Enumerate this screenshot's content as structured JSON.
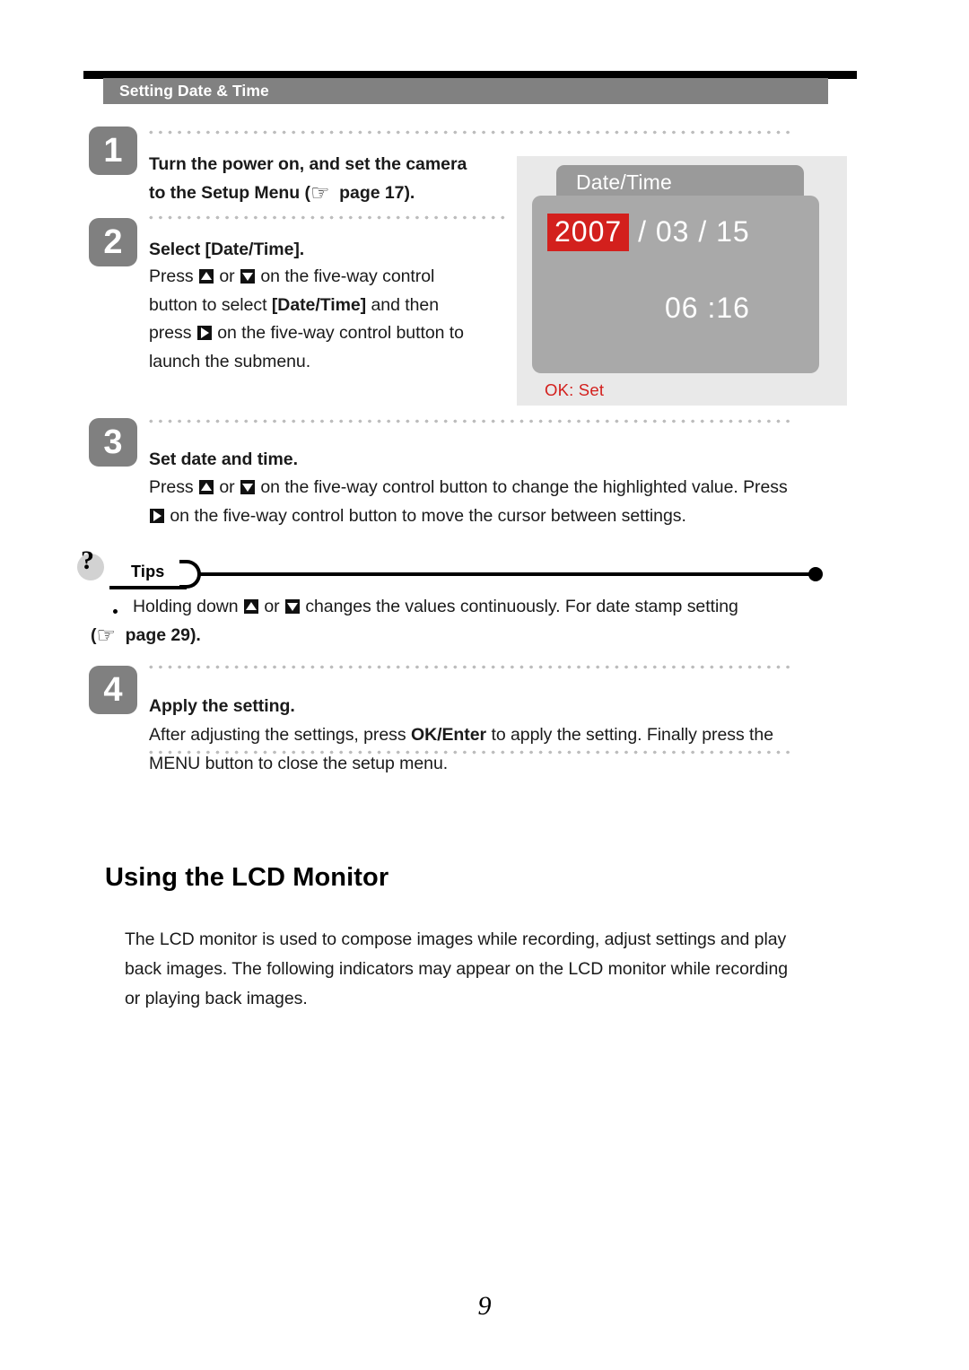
{
  "header": {
    "title": "Setting Date & Time"
  },
  "steps": [
    {
      "number": "1",
      "heading_line1": "Turn the power on, and set the camera",
      "heading_line2_pre": "to the Setup Menu (",
      "heading_icon": "pointing-hand-icon",
      "heading_line2_post": "page 17)."
    },
    {
      "number": "2",
      "heading": "Select [Date/Time].",
      "body_1": "Press",
      "body_2": "or",
      "body_3": "on the five-way control",
      "body_4": "button to select",
      "body_4b": "[Date/Time]",
      "body_4c": "and then",
      "body_5": "press",
      "body_6": "on the five-way control button to",
      "body_7": "launch the submenu."
    },
    {
      "number": "3",
      "heading": "Set date and time.",
      "body_1": "Press",
      "body_2": "or",
      "body_3": "on the five-way control button to change the highlighted value. Press",
      "body_4": "on the five-way control button to move the cursor between settings."
    },
    {
      "number": "4",
      "heading": "Apply the setting.",
      "body_1": "After adjusting the settings, press",
      "body_1b": "OK/Enter",
      "body_1c": "to apply the setting. Finally press the",
      "body_2": "MENU button to close the setup menu."
    }
  ],
  "lcd": {
    "title": "Date/Time",
    "year": "2007",
    "date_rest": "/ 03 / 15",
    "time": "06 :16",
    "ok_hint": "OK: Set",
    "highlight_color": "#d3201d",
    "panel_color": "#a9a9a9",
    "titlebar_color": "#9a9a9a",
    "frame_color": "#e9e9e9"
  },
  "tips": {
    "label": "Tips",
    "qmark": "?",
    "line1_a": "Holding down",
    "line1_b": "or",
    "line1_c": "changes the values continuously. For date stamp setting",
    "line2_pre": "(",
    "line2_icon": "pointing-hand-icon",
    "line2_post": "page 29)."
  },
  "lcd_section": {
    "heading": "Using the LCD Monitor",
    "paragraph_line1": "The LCD monitor is used to compose images while recording, adjust settings and play",
    "paragraph_line2": "back images. The following indicators may appear on the LCD monitor while recording",
    "paragraph_line3": "or playing back images."
  },
  "footer": {
    "page_number": "9"
  },
  "icons": {
    "hand": "☞",
    "up": "▲",
    "down": "▼",
    "right": "▶"
  }
}
